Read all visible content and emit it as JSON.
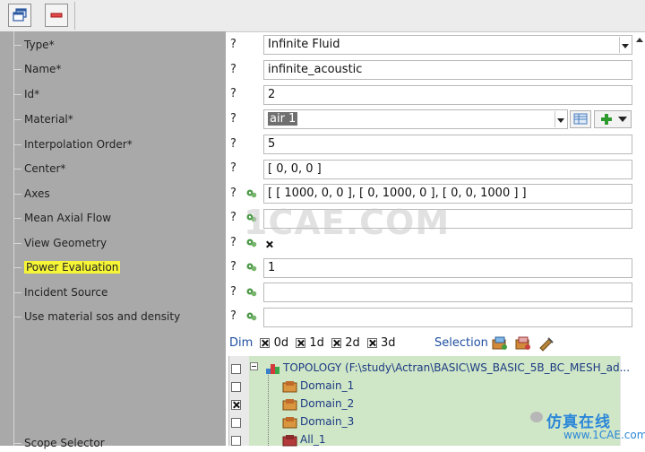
{
  "toolbar": {
    "buttons": [
      {
        "name": "windows-icon"
      },
      {
        "name": "remove-icon"
      }
    ]
  },
  "properties": [
    {
      "label": "Type*",
      "value": "Infinite Fluid",
      "kind": "dropdown",
      "gear": false
    },
    {
      "label": "Name*",
      "value": "infinite_acoustic",
      "kind": "text",
      "gear": false
    },
    {
      "label": "Id*",
      "value": "2",
      "kind": "text",
      "gear": false
    },
    {
      "label": "Material*",
      "value": "air 1",
      "kind": "material",
      "gear": false
    },
    {
      "label": "Interpolation Order*",
      "value": "5",
      "kind": "text",
      "gear": false
    },
    {
      "label": "Center*",
      "value": "[ 0, 0, 0 ]",
      "kind": "text",
      "gear": false
    },
    {
      "label": "Axes",
      "value": "[ [ 1000, 0, 0 ], [ 0, 1000, 0 ], [ 0, 0, 1000 ] ]",
      "kind": "text",
      "gear": true
    },
    {
      "label": "Mean Axial Flow",
      "value": "",
      "kind": "text",
      "gear": true
    },
    {
      "label": "View Geometry",
      "value": "",
      "kind": "checkbox",
      "checked": true,
      "gear": true
    },
    {
      "label": "Power Evaluation",
      "value": "1",
      "kind": "text",
      "gear": true,
      "highlighted": true
    },
    {
      "label": "Incident Source",
      "value": "",
      "kind": "text",
      "gear": true
    },
    {
      "label": "Use material sos and density",
      "value": "",
      "kind": "text",
      "gear": true
    }
  ],
  "help_symbol": "?",
  "scope_label": "Scope Selector",
  "dim": {
    "label": "Dim",
    "options": [
      {
        "label": "0d",
        "checked": true
      },
      {
        "label": "1d",
        "checked": true
      },
      {
        "label": "2d",
        "checked": true
      },
      {
        "label": "3d",
        "checked": true
      }
    ]
  },
  "selection_label": "Selection",
  "topology": {
    "label": "TOPOLOGY (F:\\study\\Actran\\BASIC\\WS_BASIC_5B_BC_MESH_ad...",
    "children": [
      {
        "label": "Domain_1",
        "checked": false
      },
      {
        "label": "Domain_2",
        "checked": true
      },
      {
        "label": "Domain_3",
        "checked": false
      },
      {
        "label": "All_1",
        "checked": false
      }
    ]
  },
  "watermark": "1CAE.COM",
  "brand": {
    "line1": "仿真在线",
    "line2": "www.1CAE.com"
  },
  "colors": {
    "tree_bg": "#a9a9a9",
    "highlight": "#f6f536",
    "link_blue": "#1f4fa0",
    "selection_green": "#cfe6c7"
  }
}
